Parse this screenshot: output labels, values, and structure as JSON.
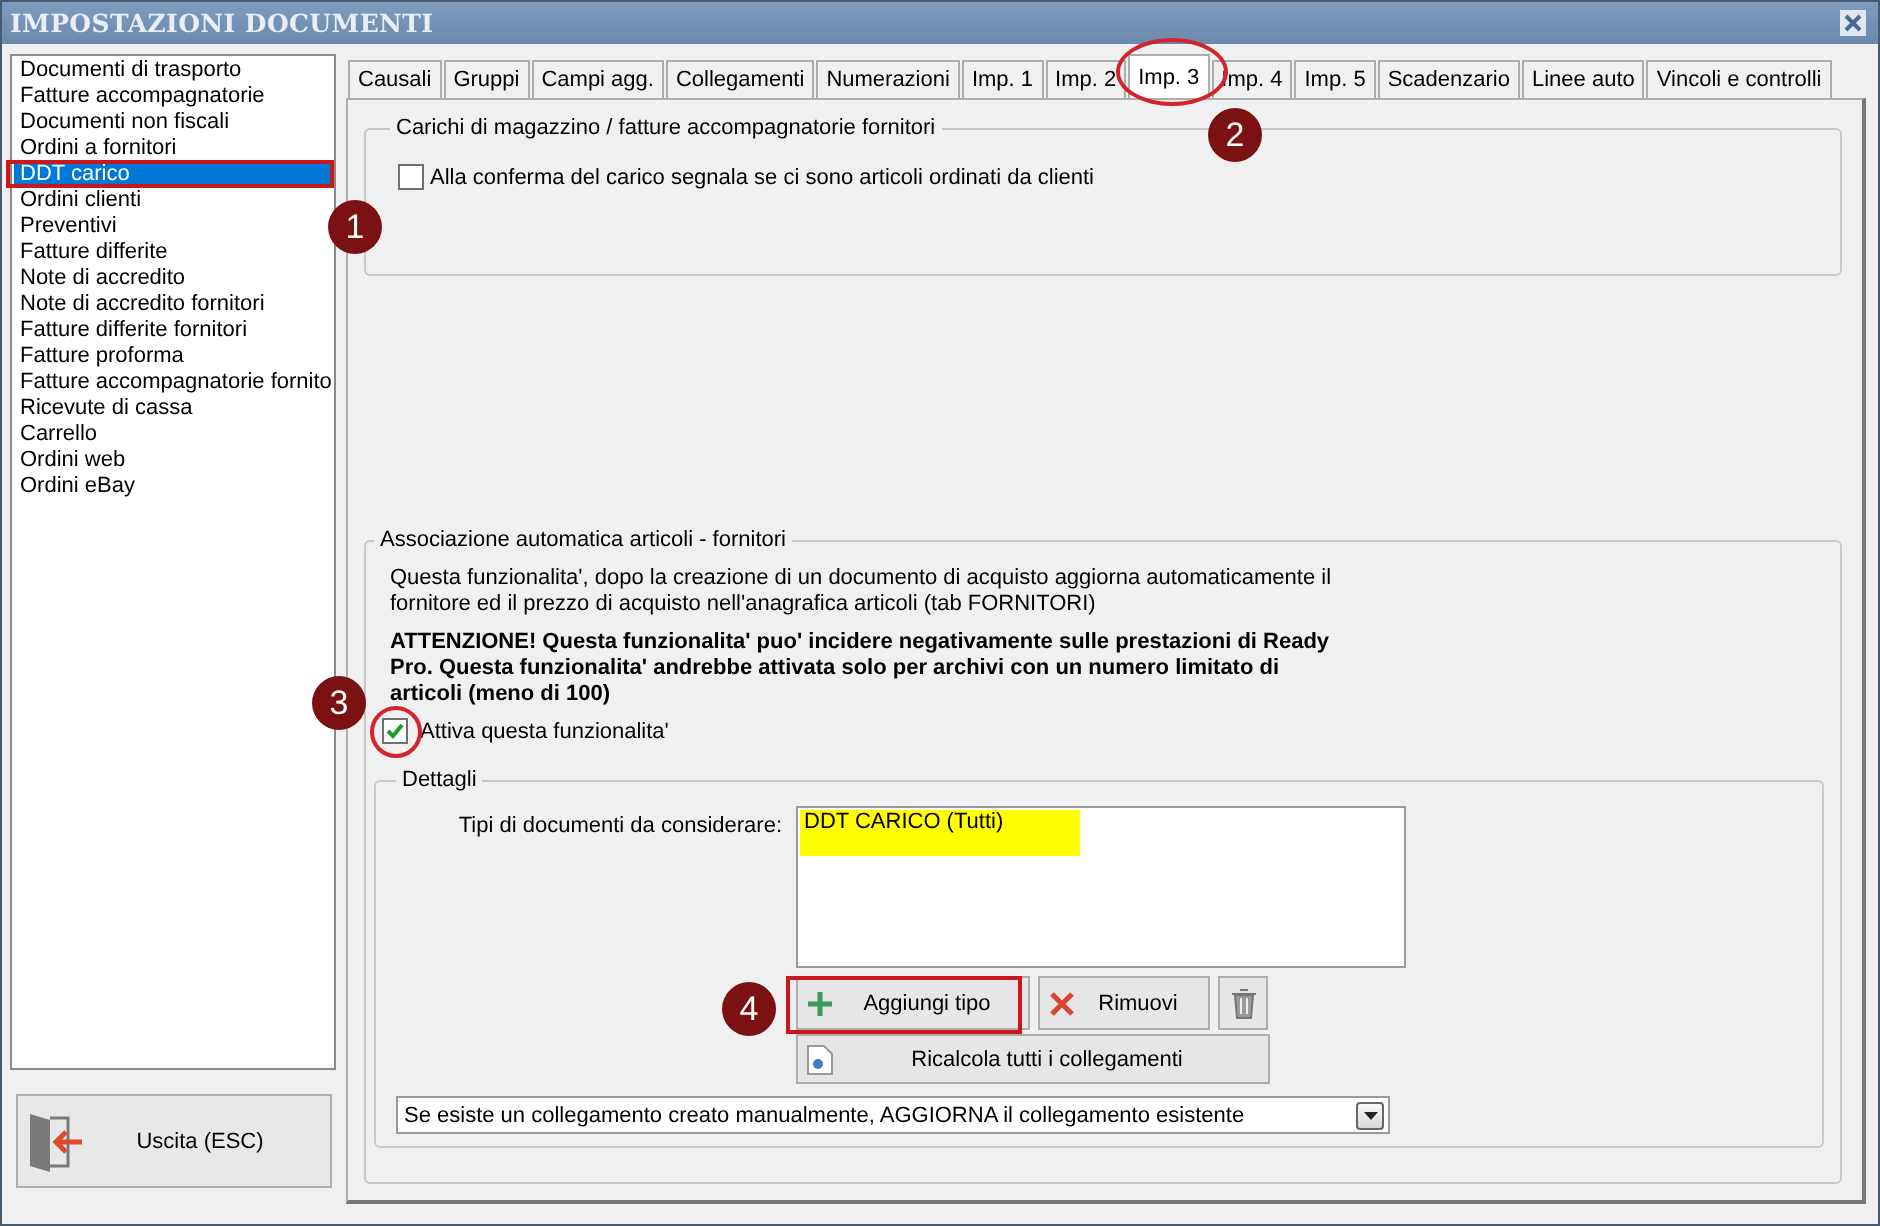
{
  "window": {
    "title": "IMPOSTAZIONI DOCUMENTI"
  },
  "document_types": [
    {
      "label": "Documenti di trasporto",
      "selected": false
    },
    {
      "label": "Fatture accompagnatorie",
      "selected": false
    },
    {
      "label": "Documenti non fiscali",
      "selected": false
    },
    {
      "label": "Ordini a fornitori",
      "selected": false
    },
    {
      "label": "DDT carico",
      "selected": true
    },
    {
      "label": "Ordini clienti",
      "selected": false
    },
    {
      "label": "Preventivi",
      "selected": false
    },
    {
      "label": "Fatture differite",
      "selected": false
    },
    {
      "label": "Note di accredito",
      "selected": false
    },
    {
      "label": "Note di accredito fornitori",
      "selected": false
    },
    {
      "label": "Fatture differite fornitori",
      "selected": false
    },
    {
      "label": "Fatture proforma",
      "selected": false
    },
    {
      "label": "Fatture accompagnatorie fornito",
      "selected": false
    },
    {
      "label": "Ricevute di cassa",
      "selected": false
    },
    {
      "label": "Carrello",
      "selected": false
    },
    {
      "label": "Ordini web",
      "selected": false
    },
    {
      "label": "Ordini eBay",
      "selected": false
    }
  ],
  "exit_button": {
    "label": "Uscita (ESC)"
  },
  "tabs": [
    {
      "label": "Causali",
      "selected": false
    },
    {
      "label": "Gruppi",
      "selected": false
    },
    {
      "label": "Campi agg.",
      "selected": false
    },
    {
      "label": "Collegamenti",
      "selected": false
    },
    {
      "label": "Numerazioni",
      "selected": false
    },
    {
      "label": "Imp. 1",
      "selected": false
    },
    {
      "label": "Imp. 2",
      "selected": false
    },
    {
      "label": "Imp. 3",
      "selected": true
    },
    {
      "label": "Imp. 4",
      "selected": false
    },
    {
      "label": "Imp. 5",
      "selected": false
    },
    {
      "label": "Scadenzario",
      "selected": false
    },
    {
      "label": "Linee auto",
      "selected": false
    },
    {
      "label": "Vincoli e controlli",
      "selected": false
    }
  ],
  "section_1": {
    "title": "Carichi di magazzino / fatture accompagnatorie fornitori",
    "checkbox": {
      "label": "Alla conferma del carico segnala se ci sono articoli ordinati da clienti",
      "checked": false
    }
  },
  "section_2": {
    "title": "Associazione automatica articoli - fornitori",
    "description": "Questa funzionalita', dopo la creazione di un documento di acquisto aggiorna automaticamente il fornitore ed il prezzo di acquisto nell'anagrafica articoli (tab FORNITORI)",
    "warning": "ATTENZIONE! Questa funzionalita' puo' incidere negativamente sulle prestazioni di Ready Pro. Questa funzionalita' andrebbe attivata solo per archivi con un numero limitato di articoli (meno di 100)",
    "checkbox": {
      "label": "Attiva questa funzionalita'",
      "checked": true
    },
    "details": {
      "title": "Dettagli",
      "list_label": "Tipi di documenti da considerare:",
      "list_items": [
        {
          "label": "DDT CARICO (Tutti)",
          "selected": true
        }
      ],
      "buttons": [
        {
          "kind": "add",
          "label": "Aggiungi tipo"
        },
        {
          "kind": "remove",
          "label": "Rimuovi"
        },
        {
          "kind": "delete"
        }
      ],
      "recalc_button": {
        "label": "Ricalcola tutti i collegamenti"
      },
      "dropdown": {
        "value": "Se esiste un collegamento creato manualmente, AGGIORNA il collegamento esistente"
      }
    }
  },
  "callouts": [
    {
      "label": "1"
    },
    {
      "label": "2"
    },
    {
      "label": "3"
    },
    {
      "label": "4"
    }
  ]
}
